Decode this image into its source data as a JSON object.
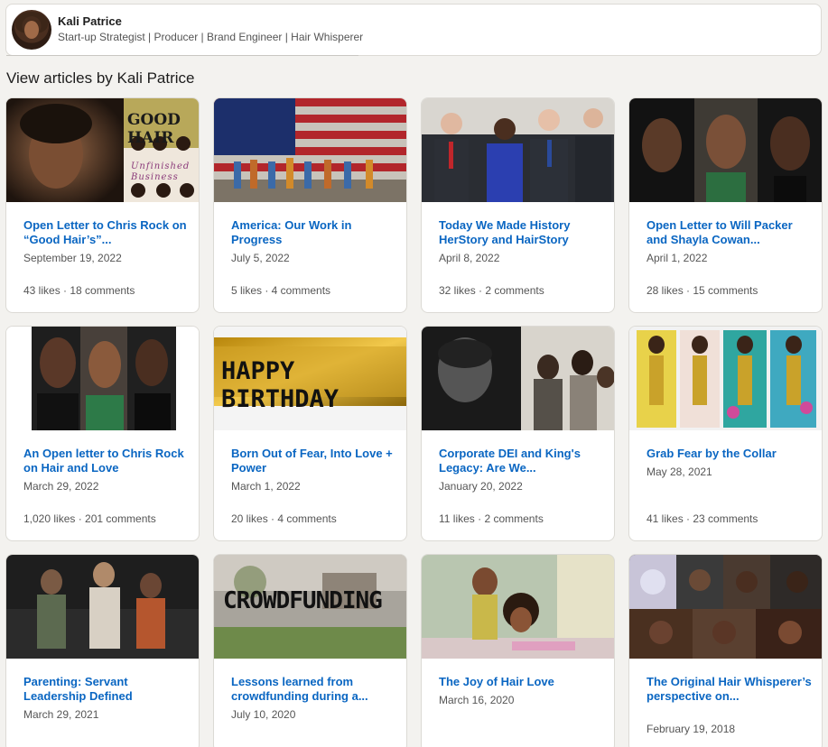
{
  "profile": {
    "name": "Kali Patrice",
    "headline": "Start-up Strategist | Producer | Brand Engineer | Hair Whisperer"
  },
  "section_title": "View articles by Kali Patrice",
  "articles": [
    {
      "title": "Open Letter to Chris Rock on “Good Hair’s”...",
      "date": "September 19, 2022",
      "stats": "43 likes · 18 comments",
      "thumb_text": "GOOD HAIR",
      "thumb_subtext": "Unfinished Business"
    },
    {
      "title": "America: Our Work in Progress",
      "date": "July 5, 2022",
      "stats": "5 likes · 4 comments"
    },
    {
      "title": "Today We Made History HerStory and HairStory",
      "date": "April 8, 2022",
      "stats": "32 likes · 2 comments"
    },
    {
      "title": "Open Letter to Will Packer and Shayla Cowan...",
      "date": "April 1, 2022",
      "stats": "28 likes · 15 comments"
    },
    {
      "title": "An Open letter to Chris Rock on Hair and Love",
      "date": "March 29, 2022",
      "stats": "1,020 likes · 201 comments"
    },
    {
      "title": "Born Out of Fear, Into Love + Power",
      "date": "March 1, 2022",
      "stats": "20 likes · 4 comments",
      "thumb_text": "HAPPY BIRTHDAY"
    },
    {
      "title": "Corporate DEI and King's Legacy: Are We...",
      "date": "January 20, 2022",
      "stats": "11 likes · 2 comments"
    },
    {
      "title": "Grab Fear by the Collar",
      "date": "May 28, 2021",
      "stats": "41 likes · 23 comments"
    },
    {
      "title": "Parenting: Servant Leadership Defined",
      "date": "March 29, 2021",
      "stats": ""
    },
    {
      "title": "Lessons learned from crowdfunding during a...",
      "date": "July 10, 2020",
      "stats": "",
      "thumb_text": "CROWDFUNDING"
    },
    {
      "title": "The Joy of Hair Love",
      "date": "March 16, 2020",
      "stats": ""
    },
    {
      "title": "The Original Hair Whisperer’s perspective on...",
      "date": "February 19, 2018",
      "stats": ""
    }
  ]
}
